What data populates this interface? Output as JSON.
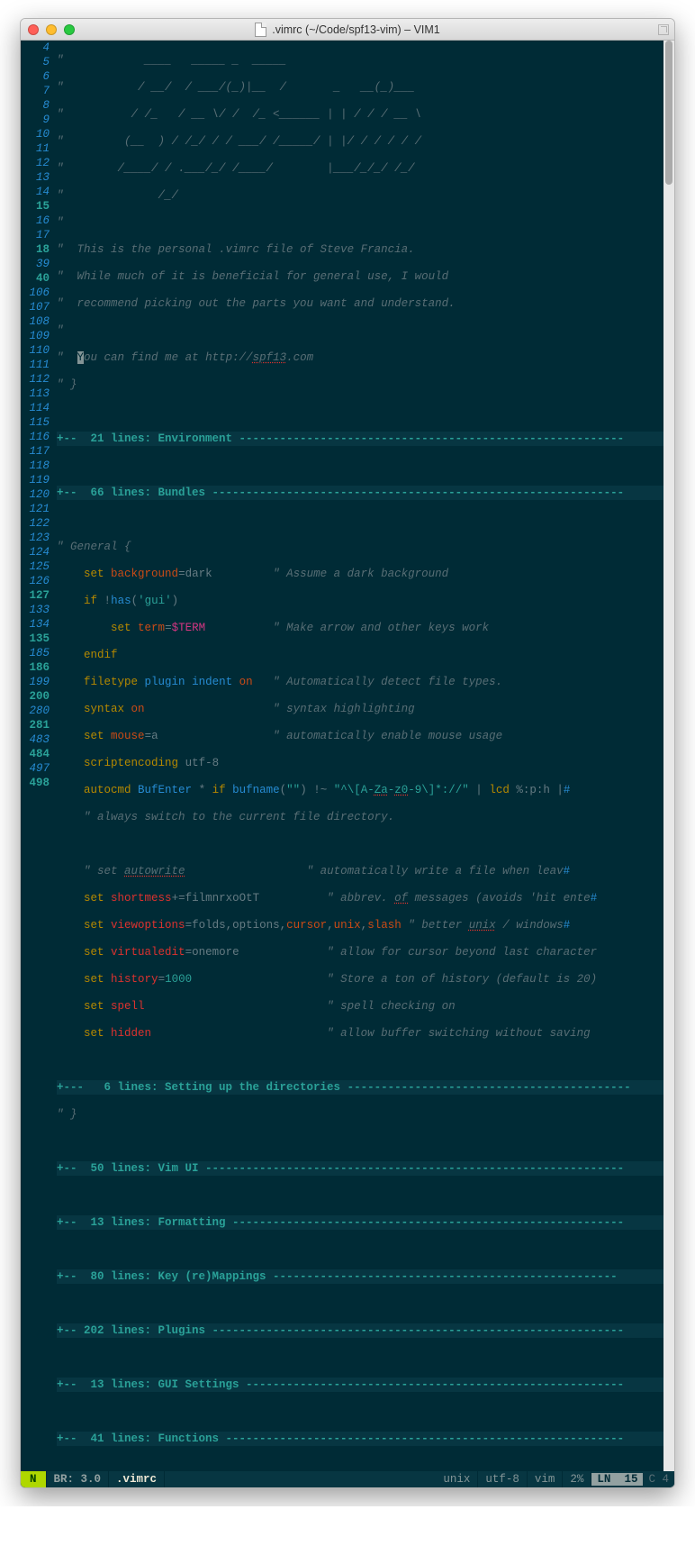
{
  "window": {
    "title": ".vimrc (~/Code/spf13-vim) – VIM1"
  },
  "ascii": [
    "            ____   _____ _  _____                    ",
    "           / __/  / ___/(_)|__  /       _   __(_)___ ",
    "          / /_   / __ \\/ /  /_ <______ | | / / / __ \\",
    "         (__  ) / /_/ / / ___/ /_____/ | |/ / / / / /",
    "        /____/ / .___/_/ /____/        |___/_/_/ /_/ ",
    "              /_/                                   "
  ],
  "intro": {
    "l11": "  This is the personal .vimrc file of Steve Francia.",
    "l12": "  While much of it is beneficial for general use, I would",
    "l13": "  recommend picking out the parts you want and understand.",
    "l15a": "  ",
    "l15cursor": "Y",
    "l15b": "ou can find me at http://",
    "l15c": "spf13",
    "l15d": ".com"
  },
  "folds": {
    "f18": "+--  21 lines: Environment ",
    "f40": "+--  66 lines: Bundles ",
    "f127": "+---   6 lines: Setting up the directories ",
    "f135": "+--  50 lines: Vim UI ",
    "f186": "+--  13 lines: Formatting ",
    "f200": "+--  80 lines: Key (re)Mappings ",
    "f281": "+-- 202 lines: Plugins ",
    "f484": "+--  13 lines: GUI Settings ",
    "f498": "+--  41 lines: Functions "
  },
  "general": {
    "header": "\" General {",
    "l108_c1": "\" Assume a dark background",
    "l110_c": "\" Make arrow and other keys work",
    "l112_c": "\" Automatically detect file types.",
    "l113_c": "\" syntax highlighting",
    "l114_c": "\" automatically enable mouse usage",
    "l117_c": "\" always switch to the current file directory.",
    "l119_c": "\" automatically write a file when leav",
    "l119_a": "\" set ",
    "l119_b": "autowrite",
    "l120_c": "\" abbrev. ",
    "l120_of": "of",
    "l120_c2": " messages (avoids 'hit ente",
    "l121_c": "\" better ",
    "l121_u": "unix",
    "l121_c2": " / windows",
    "l122_c": "\" allow for cursor beyond last character",
    "l123_c": "\" Store a ton of history (default is 20)",
    "l124_c": "\" spell checking on",
    "l125_c": "\" allow buffer switching without saving"
  },
  "status": {
    "mode": "N",
    "branch": "BR: 3.0",
    "file": ".vimrc",
    "ff": "unix",
    "enc": "utf-8",
    "ft": "vim",
    "pct": "2%",
    "lnlabel": "LN",
    "ln": "15",
    "collabel": "C",
    "col": "4"
  },
  "nums": {
    "n4": "4",
    "n5": "5",
    "n6": "6",
    "n7": "7",
    "n8": "8",
    "n9": "9",
    "n10": "10",
    "n11": "11",
    "n12": "12",
    "n13": "13",
    "n14": "14",
    "n15": "15",
    "n16": "16",
    "n17": "17",
    "n18": "18",
    "n39": "39",
    "n40": "40",
    "n106": "106",
    "n107": "107",
    "n108": "108",
    "n109": "109",
    "n110": "110",
    "n111": "111",
    "n112": "112",
    "n113": "113",
    "n114": "114",
    "n115": "115",
    "n116": "116",
    "n117": "117",
    "n118": "118",
    "n119": "119",
    "n120": "120",
    "n121": "121",
    "n122": "122",
    "n123": "123",
    "n124": "124",
    "n125": "125",
    "n126": "126",
    "n127": "127",
    "n133": "133",
    "n134": "134",
    "n135": "135",
    "n185": "185",
    "n186": "186",
    "n199": "199",
    "n200": "200",
    "n280": "280",
    "n281": "281",
    "n483": "483",
    "n484": "484",
    "n497": "497",
    "n498": "498"
  }
}
